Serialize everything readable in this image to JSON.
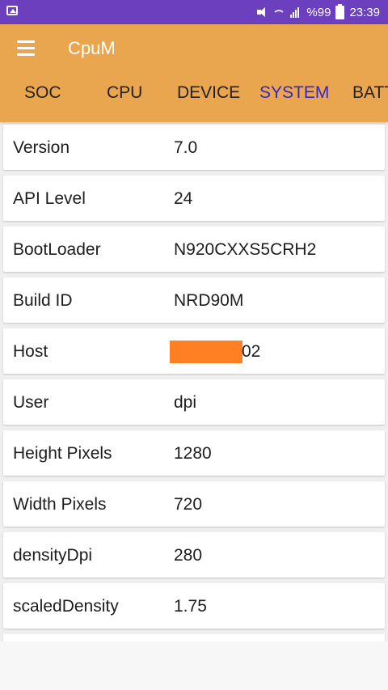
{
  "status_bar": {
    "battery_text": "%99",
    "time": "23:39"
  },
  "app": {
    "title": "CpuM"
  },
  "tabs": [
    {
      "label": "SOC",
      "active": false
    },
    {
      "label": "CPU",
      "active": false
    },
    {
      "label": "DEVICE",
      "active": false
    },
    {
      "label": "SYSTEM",
      "active": true
    },
    {
      "label": "BATT",
      "active": false
    }
  ],
  "system_info": [
    {
      "label": "Version",
      "value": "7.0"
    },
    {
      "label": "API Level",
      "value": "24"
    },
    {
      "label": "BootLoader",
      "value": "N920CXXS5CRH2"
    },
    {
      "label": "Build ID",
      "value": "NRD90M"
    },
    {
      "label": "Host",
      "value": "02"
    },
    {
      "label": "User",
      "value": "dpi"
    },
    {
      "label": "Height Pixels",
      "value": "1280"
    },
    {
      "label": "Width Pixels",
      "value": "720"
    },
    {
      "label": "densityDpi",
      "value": "280"
    },
    {
      "label": "scaledDensity",
      "value": "1.75"
    }
  ],
  "colors": {
    "status_bar": "#6b3fbe",
    "app_bar": "#e9a64f",
    "active_tab": "#3726c7",
    "redaction": "#ff7f23"
  },
  "icons": {
    "menu": "hamburger-menu-icon",
    "status_left": "image-icon",
    "mute": "mute-icon",
    "wifi": "wifi-icon",
    "signal": "signal-icon",
    "battery": "battery-icon"
  }
}
